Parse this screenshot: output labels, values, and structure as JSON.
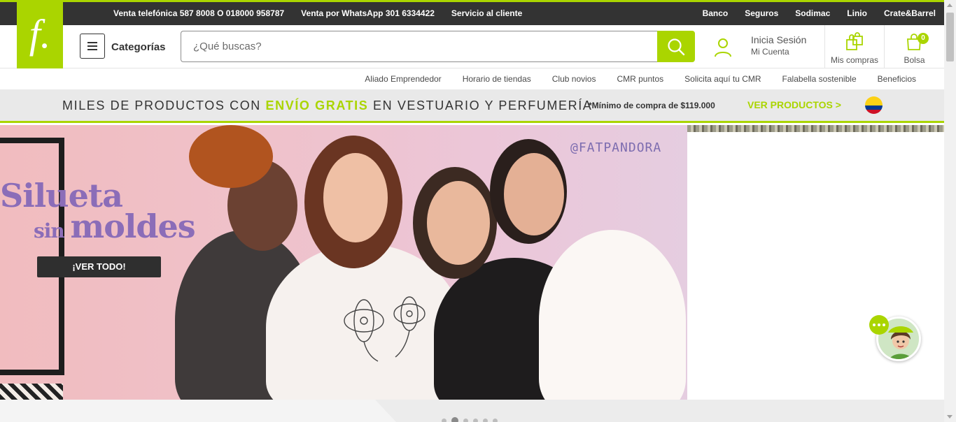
{
  "topbar": {
    "left_links": [
      "Venta telefónica 587 8008 O 018000 958787",
      "Venta por WhatsApp 301 6334422",
      "Servicio al cliente"
    ],
    "right_links": [
      "Banco",
      "Seguros",
      "Sodimac",
      "Linio",
      "Crate&Barrel"
    ]
  },
  "logo": {
    "glyph": "f."
  },
  "header": {
    "categories_label": "Categorías",
    "search_placeholder": "¿Qué buscas?",
    "login_title": "Inicia Sesión",
    "login_sub": "Mi Cuenta",
    "purchases_label": "Mis compras",
    "bag_label": "Bolsa",
    "bag_count": "0"
  },
  "subnav": {
    "links": [
      "Aliado Emprendedor",
      "Horario de tiendas",
      "Club novios",
      "CMR puntos",
      "Solicita aquí tu CMR",
      "Falabella sostenible",
      "Beneficios"
    ]
  },
  "promo": {
    "text_before": "MILES DE PRODUCTOS CON ",
    "text_highlight": "ENVÍO GRATIS",
    "text_after": " EN VESTUARIO Y PERFUMERÍA",
    "min_purchase": "*Mínimo de compra de $119.000",
    "cta": "VER PRODUCTOS >"
  },
  "hero": {
    "title_line1": "Silueta",
    "title_line2_small": "sin ",
    "title_line2_big": "moldes",
    "button": "¡VER TODO!",
    "tag": "@FATPANDORA"
  },
  "colors": {
    "accent": "#aad500",
    "topbar": "#333333",
    "hero_title": "#8b6db8"
  },
  "carousel": {
    "total": 6,
    "active": 1
  }
}
